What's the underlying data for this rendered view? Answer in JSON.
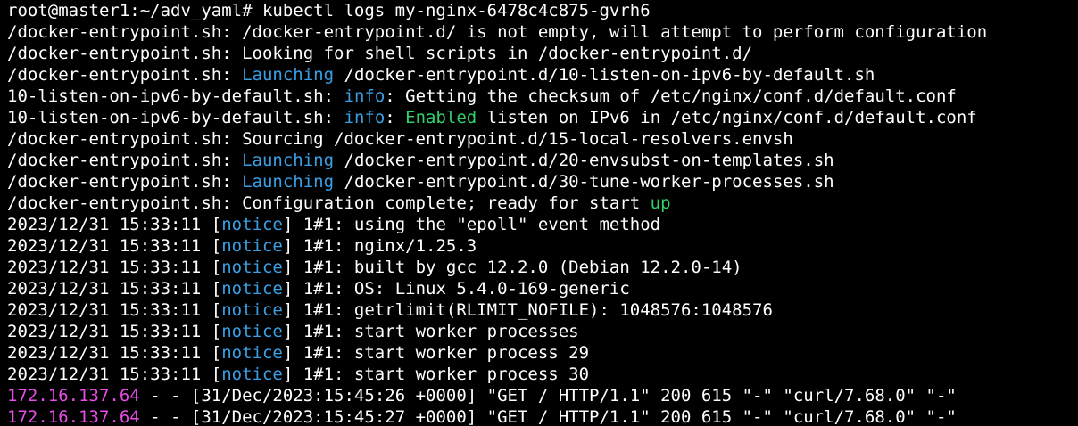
{
  "colors": {
    "background": "#000000",
    "default": "#ffffff",
    "launching": "#3a9ee5",
    "info": "#3a9ee5",
    "enabled": "#2fd26a",
    "up": "#2fd26a",
    "notice": "#3a9ee5",
    "ip": "#e84de8"
  },
  "lines": [
    [
      {
        "text": "root@master1:~/adv_yaml# kubectl logs my-nginx-6478c4c875-gvrh6",
        "color": "#ffffff"
      }
    ],
    [
      {
        "text": "/docker-entrypoint.sh: /docker-entrypoint.d/ is not empty, will attempt to perform configuration",
        "color": "#ffffff"
      }
    ],
    [
      {
        "text": "/docker-entrypoint.sh: Looking for shell scripts in /docker-entrypoint.d/",
        "color": "#ffffff"
      }
    ],
    [
      {
        "text": "/docker-entrypoint.sh: ",
        "color": "#ffffff"
      },
      {
        "text": "Launching",
        "color": "#3a9ee5"
      },
      {
        "text": " /docker-entrypoint.d/10-listen-on-ipv6-by-default.sh",
        "color": "#ffffff"
      }
    ],
    [
      {
        "text": "10-listen-on-ipv6-by-default.sh: ",
        "color": "#ffffff"
      },
      {
        "text": "info",
        "color": "#3a9ee5"
      },
      {
        "text": ": Getting the checksum of /etc/nginx/conf.d/default.conf",
        "color": "#ffffff"
      }
    ],
    [
      {
        "text": "10-listen-on-ipv6-by-default.sh: ",
        "color": "#ffffff"
      },
      {
        "text": "info",
        "color": "#3a9ee5"
      },
      {
        "text": ": ",
        "color": "#ffffff"
      },
      {
        "text": "Enabled",
        "color": "#2fd26a"
      },
      {
        "text": " listen on IPv6 in /etc/nginx/conf.d/default.conf",
        "color": "#ffffff"
      }
    ],
    [
      {
        "text": "/docker-entrypoint.sh: Sourcing /docker-entrypoint.d/15-local-resolvers.envsh",
        "color": "#ffffff"
      }
    ],
    [
      {
        "text": "/docker-entrypoint.sh: ",
        "color": "#ffffff"
      },
      {
        "text": "Launching",
        "color": "#3a9ee5"
      },
      {
        "text": " /docker-entrypoint.d/20-envsubst-on-templates.sh",
        "color": "#ffffff"
      }
    ],
    [
      {
        "text": "/docker-entrypoint.sh: ",
        "color": "#ffffff"
      },
      {
        "text": "Launching",
        "color": "#3a9ee5"
      },
      {
        "text": " /docker-entrypoint.d/30-tune-worker-processes.sh",
        "color": "#ffffff"
      }
    ],
    [
      {
        "text": "/docker-entrypoint.sh: Configuration complete; ready for start ",
        "color": "#ffffff"
      },
      {
        "text": "up",
        "color": "#2fd26a"
      }
    ],
    [
      {
        "text": "2023/12/31 15:33:11 [",
        "color": "#ffffff"
      },
      {
        "text": "notice",
        "color": "#3a9ee5"
      },
      {
        "text": "] 1#1: using the \"epoll\" event method",
        "color": "#ffffff"
      }
    ],
    [
      {
        "text": "2023/12/31 15:33:11 [",
        "color": "#ffffff"
      },
      {
        "text": "notice",
        "color": "#3a9ee5"
      },
      {
        "text": "] 1#1: nginx/1.25.3",
        "color": "#ffffff"
      }
    ],
    [
      {
        "text": "2023/12/31 15:33:11 [",
        "color": "#ffffff"
      },
      {
        "text": "notice",
        "color": "#3a9ee5"
      },
      {
        "text": "] 1#1: built by gcc 12.2.0 (Debian 12.2.0-14)",
        "color": "#ffffff"
      }
    ],
    [
      {
        "text": "2023/12/31 15:33:11 [",
        "color": "#ffffff"
      },
      {
        "text": "notice",
        "color": "#3a9ee5"
      },
      {
        "text": "] 1#1: OS: Linux 5.4.0-169-generic",
        "color": "#ffffff"
      }
    ],
    [
      {
        "text": "2023/12/31 15:33:11 [",
        "color": "#ffffff"
      },
      {
        "text": "notice",
        "color": "#3a9ee5"
      },
      {
        "text": "] 1#1: getrlimit(RLIMIT_NOFILE): 1048576:1048576",
        "color": "#ffffff"
      }
    ],
    [
      {
        "text": "2023/12/31 15:33:11 [",
        "color": "#ffffff"
      },
      {
        "text": "notice",
        "color": "#3a9ee5"
      },
      {
        "text": "] 1#1: start worker processes",
        "color": "#ffffff"
      }
    ],
    [
      {
        "text": "2023/12/31 15:33:11 [",
        "color": "#ffffff"
      },
      {
        "text": "notice",
        "color": "#3a9ee5"
      },
      {
        "text": "] 1#1: start worker process 29",
        "color": "#ffffff"
      }
    ],
    [
      {
        "text": "2023/12/31 15:33:11 [",
        "color": "#ffffff"
      },
      {
        "text": "notice",
        "color": "#3a9ee5"
      },
      {
        "text": "] 1#1: start worker process 30",
        "color": "#ffffff"
      }
    ],
    [
      {
        "text": "172.16.137.64",
        "color": "#e84de8"
      },
      {
        "text": " - - [31/Dec/2023:15:45:26 +0000] \"GET / HTTP/1.1\" 200 615 \"-\" \"curl/7.68.0\" \"-\"",
        "color": "#ffffff"
      }
    ],
    [
      {
        "text": "172.16.137.64",
        "color": "#e84de8"
      },
      {
        "text": " - - [31/Dec/2023:15:45:27 +0000] \"GET / HTTP/1.1\" 200 615 \"-\" \"curl/7.68.0\" \"-\"",
        "color": "#ffffff"
      }
    ]
  ]
}
